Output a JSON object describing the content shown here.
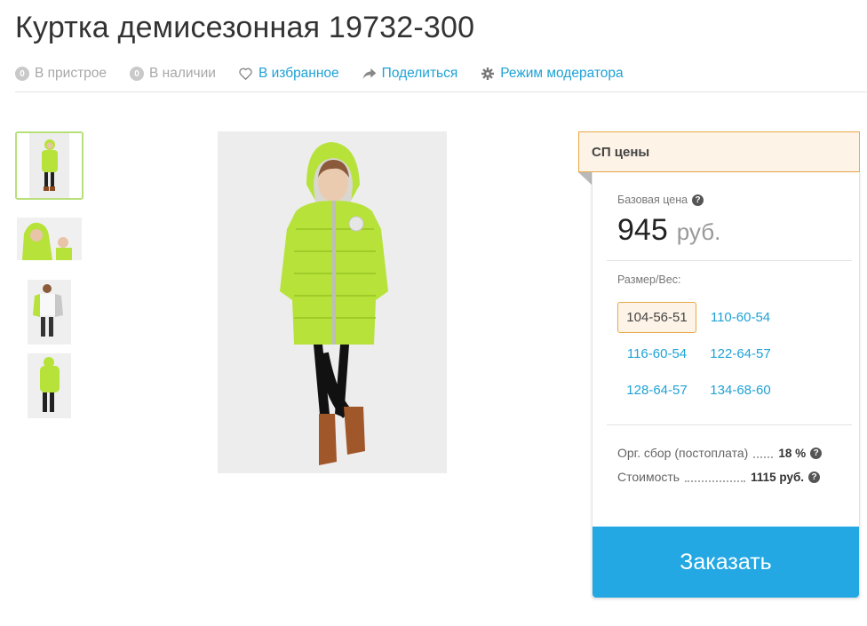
{
  "product": {
    "title": "Куртка демисезонная 19732-300"
  },
  "actions": {
    "pristroy_count": "0",
    "pristroy_label": "В пристрое",
    "stock_count": "0",
    "stock_label": "В наличии",
    "favorite_label": "В избранное",
    "share_label": "Поделиться",
    "moderator_label": "Режим модератора"
  },
  "panel": {
    "header": "СП цены",
    "base_price_label": "Базовая цена",
    "base_price_value": "945",
    "currency": "руб.",
    "size_label": "Размер/Вес:",
    "sizes": [
      {
        "label": "104-56-51",
        "selected": true
      },
      {
        "label": "110-60-54",
        "selected": false
      },
      {
        "label": "116-60-54",
        "selected": false
      },
      {
        "label": "122-64-57",
        "selected": false
      },
      {
        "label": "128-64-57",
        "selected": false
      },
      {
        "label": "134-68-60",
        "selected": false
      }
    ],
    "org_fee_label": "Орг. сбор (постоплата)",
    "org_fee_value": "18 %",
    "cost_label": "Стоимость",
    "cost_value": "1115 руб.",
    "order_button": "Заказать"
  },
  "colors": {
    "accent_blue": "#1fa2d6",
    "order_button": "#24a8e3",
    "header_bg": "#fdf3e7",
    "header_border": "#e9a94a",
    "jacket_green": "#b6e23a"
  }
}
